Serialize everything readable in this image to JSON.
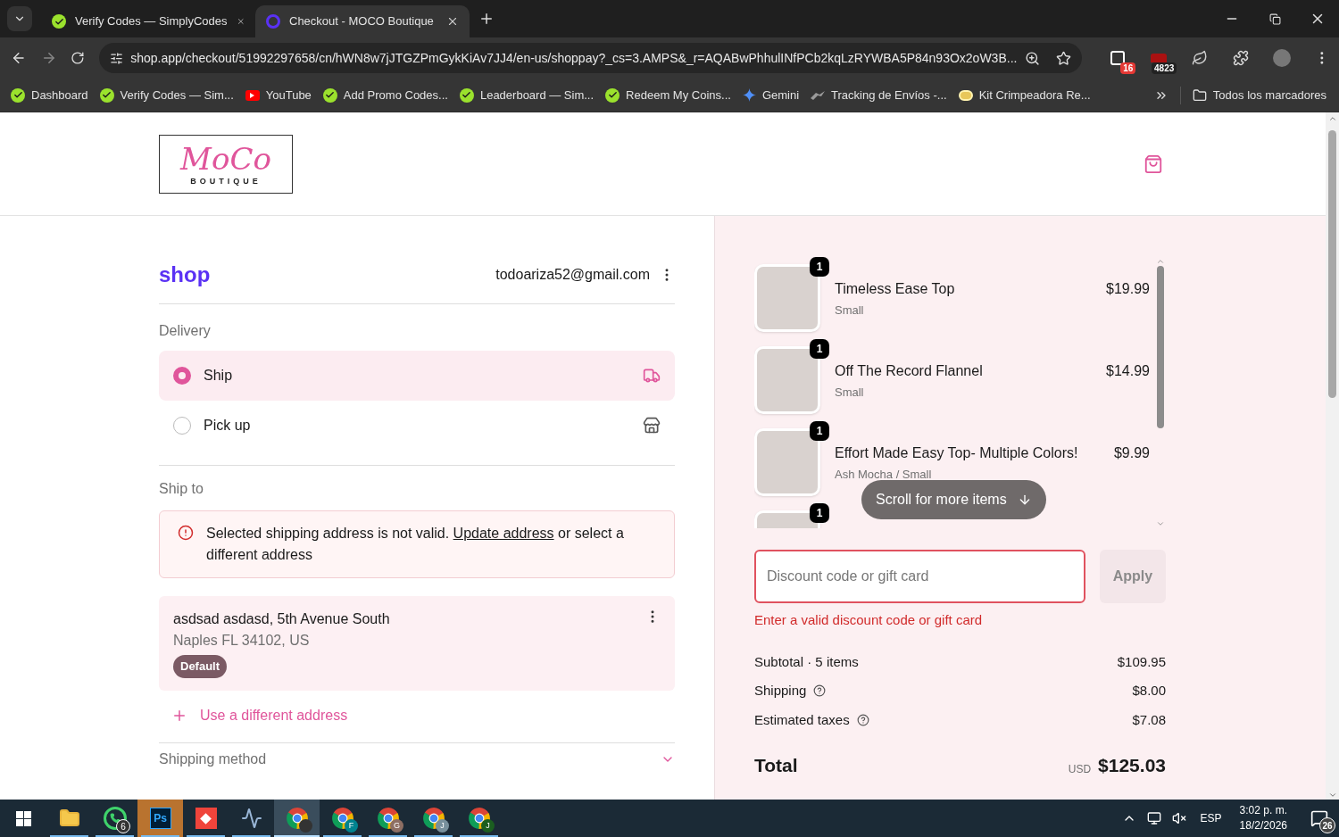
{
  "browser": {
    "tabs": [
      {
        "title": "Verify Codes — SimplyCodes",
        "kind": "simplycodes",
        "selected": false
      },
      {
        "title": "Checkout - MOCO Boutique",
        "kind": "shop",
        "selected": true
      }
    ],
    "url": "shop.app/checkout/51992297658/cn/hWN8w7jJTGZPmGykKiAv7JJ4/en-us/shoppay?_cs=3.AMPS&_r=AQABwPhhulINfPCb2kqLzRYWBA5P84n93Ox2oW3B...",
    "extensions": [
      {
        "kind": "square",
        "badge": "16"
      },
      {
        "kind": "box",
        "badge": "4823"
      },
      {
        "kind": "leaf"
      },
      {
        "kind": "puzzle"
      },
      {
        "kind": "avatar"
      }
    ],
    "bookmarks": [
      {
        "label": "Dashboard",
        "kind": "simplycodes"
      },
      {
        "label": "Verify Codes — Sim...",
        "kind": "simplycodes"
      },
      {
        "label": "YouTube",
        "kind": "youtube"
      },
      {
        "label": "Add Promo Codes...",
        "kind": "simplycodes"
      },
      {
        "label": "Leaderboard — Sim...",
        "kind": "simplycodes"
      },
      {
        "label": "Redeem My Coins...",
        "kind": "simplycodes"
      },
      {
        "label": "Gemini",
        "kind": "gemini"
      },
      {
        "label": "Tracking de Envíos -...",
        "kind": "bird"
      },
      {
        "label": "Kit Crimpeadora Re...",
        "kind": "coin"
      }
    ],
    "all_bookmarks": "Todos los marcadores"
  },
  "store": {
    "logo": "MoCo",
    "logo_subtitle": "BOUTIQUE"
  },
  "account": {
    "brand": "shop",
    "email": "todoariza52@gmail.com"
  },
  "delivery": {
    "title": "Delivery",
    "options": [
      {
        "label": "Ship",
        "kind": "truck",
        "selected": true
      },
      {
        "label": "Pick up",
        "kind": "store",
        "selected": false
      }
    ]
  },
  "ship_to": {
    "title": "Ship to",
    "error_before": "Selected shipping address is not valid. ",
    "error_link": "Update address",
    "error_after": " or select a different address",
    "address": {
      "line1": "asdsad asdasd, 5th Avenue South",
      "line2": "Naples FL 34102, US",
      "badge": "Default"
    },
    "use_different": "Use a different address"
  },
  "next_section": "Shipping method",
  "cart": {
    "items": [
      {
        "name": "Timeless Ease Top",
        "variant": "Small",
        "price": "$19.99",
        "quantity": "1"
      },
      {
        "name": "Off The Record Flannel",
        "variant": "Small",
        "price": "$14.99",
        "quantity": "1"
      },
      {
        "name": "Effort Made Easy Top- Multiple Colors!",
        "variant": "Ash Mocha / Small",
        "price": "$9.99",
        "quantity": "1"
      },
      {
        "quantity": "1"
      }
    ],
    "scroll_hint": "Scroll for more items"
  },
  "discount": {
    "placeholder": "Discount code or gift card",
    "button": "Apply",
    "invalid": true,
    "error": "Enter a valid discount code or gift card"
  },
  "summary": {
    "lines": [
      {
        "label": "Subtotal · 5 items",
        "value": "$109.95",
        "info": false
      },
      {
        "label": "Shipping",
        "value": "$8.00",
        "info": true
      },
      {
        "label": "Estimated taxes",
        "value": "$7.08",
        "info": true
      }
    ],
    "total_label": "Total",
    "currency": "USD",
    "total": "$125.03"
  },
  "taskbar": {
    "apps": [
      {
        "kind": "explorer",
        "selected": false,
        "flashing": false
      },
      {
        "kind": "whatsapp",
        "badge": "6",
        "selected": false,
        "flashing": false
      },
      {
        "kind": "photoshop",
        "label": "Ps",
        "selected": false,
        "flashing": true
      },
      {
        "kind": "anydesk",
        "selected": false,
        "flashing": false
      },
      {
        "kind": "monitor",
        "selected": false,
        "flashing": false
      },
      {
        "kind": "chrome",
        "selected": true,
        "flashing": false,
        "color": "#333333"
      },
      {
        "kind": "chrome",
        "badge": "F",
        "color": "#00838f",
        "selected": false,
        "flashing": false
      },
      {
        "kind": "chrome",
        "badge": "G",
        "color": "#8d6e63",
        "selected": false,
        "flashing": false
      },
      {
        "kind": "chrome",
        "badge": "J",
        "color": "#78909c",
        "selected": false,
        "flashing": false
      },
      {
        "kind": "chrome",
        "badge": "J",
        "color": "#1b5e20",
        "selected": false,
        "flashing": false
      }
    ],
    "language": "ESP",
    "time": "3:02 p. m.",
    "date": "18/2/2026",
    "notifications": "26"
  }
}
